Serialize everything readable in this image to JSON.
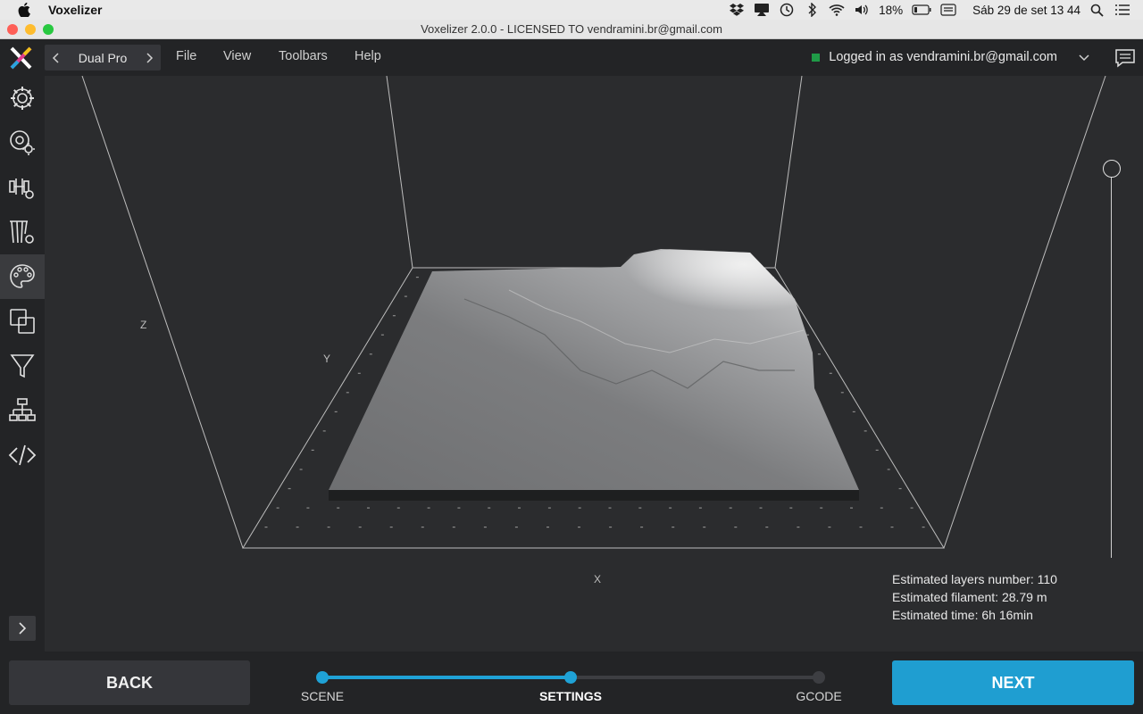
{
  "menubar": {
    "app_name": "Voxelizer",
    "battery": "18%",
    "datetime": "Sáb 29 de set  13 44"
  },
  "window": {
    "title": "Voxelizer 2.0.0 - LICENSED TO vendramini.br@gmail.com"
  },
  "topbar": {
    "printer": "Dual Pro",
    "menu": [
      "File",
      "View",
      "Toolbars",
      "Help"
    ],
    "login_text": "Logged in as vendramini.br@gmail.com",
    "status_color": "#1f9b47"
  },
  "sidebar": {
    "items": [
      {
        "icon": "gear-icon"
      },
      {
        "icon": "material-settings-icon"
      },
      {
        "icon": "extruder-settings-icon"
      },
      {
        "icon": "support-settings-icon"
      },
      {
        "icon": "palette-icon",
        "active": true
      },
      {
        "icon": "overlap-icon"
      },
      {
        "icon": "filter-icon"
      },
      {
        "icon": "hierarchy-icon"
      },
      {
        "icon": "code-icon"
      }
    ],
    "expand_icon": "chevron-right-icon"
  },
  "viewport": {
    "axis_labels": {
      "z": "Z",
      "y": "Y",
      "x": "X"
    },
    "estimates": {
      "layers": "Estimated layers number: 110",
      "filament": "Estimated filament: 28.79 m",
      "time": "Estimated time: 6h 16min"
    }
  },
  "bottombar": {
    "back_label": "BACK",
    "next_label": "NEXT",
    "steps": [
      "SCENE",
      "SETTINGS",
      "GCODE"
    ],
    "current_step": 1,
    "accent": "#1fa2d6"
  }
}
